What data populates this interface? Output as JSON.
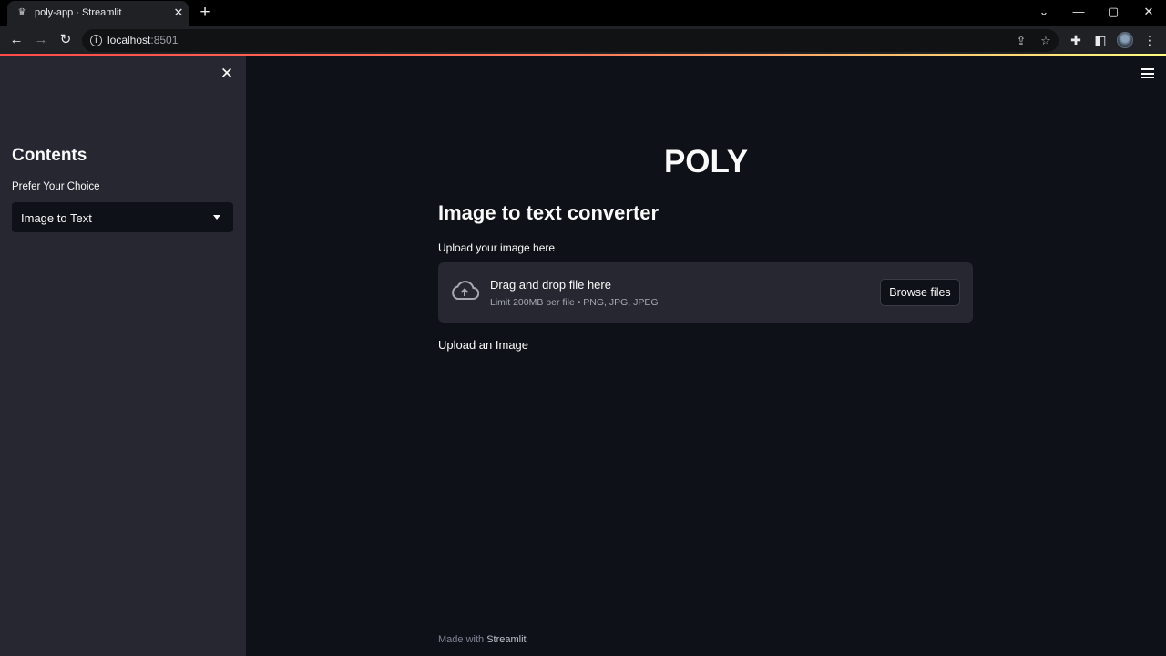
{
  "browser": {
    "tab_title": "poly-app · Streamlit",
    "tab_close": "✕",
    "new_tab": "+",
    "url_host": "localhost",
    "url_port": ":8501",
    "window_controls": {
      "minimize": "—",
      "maximize": "▢",
      "close": "✕",
      "tab_search": "⌄"
    },
    "nav": {
      "back": "←",
      "forward": "→",
      "reload": "↻"
    },
    "icons": [
      "info-icon",
      "share-icon",
      "star-icon",
      "extensions-icon",
      "side-panel-icon",
      "profile-avatar",
      "menu-dots-icon"
    ]
  },
  "sidebar": {
    "close_glyph": "✕",
    "heading": "Contents",
    "select_label": "Prefer Your Choice",
    "select_value": "Image to Text"
  },
  "main": {
    "title": "POLY",
    "subtitle": "Image to text converter",
    "uploader_label": "Upload your image here",
    "dropzone_title": "Drag and drop file here",
    "dropzone_limit": "Limit 200MB per file • PNG, JPG, JPEG",
    "browse_button": "Browse files",
    "status_text": "Upload an Image",
    "footer_prefix": "Made with ",
    "footer_brand": "Streamlit"
  },
  "colors": {
    "background": "#0e1117",
    "sidebar": "#262730",
    "accent_bar": [
      "#ff4b4b",
      "#fffd80"
    ],
    "text": "#fafafa"
  }
}
